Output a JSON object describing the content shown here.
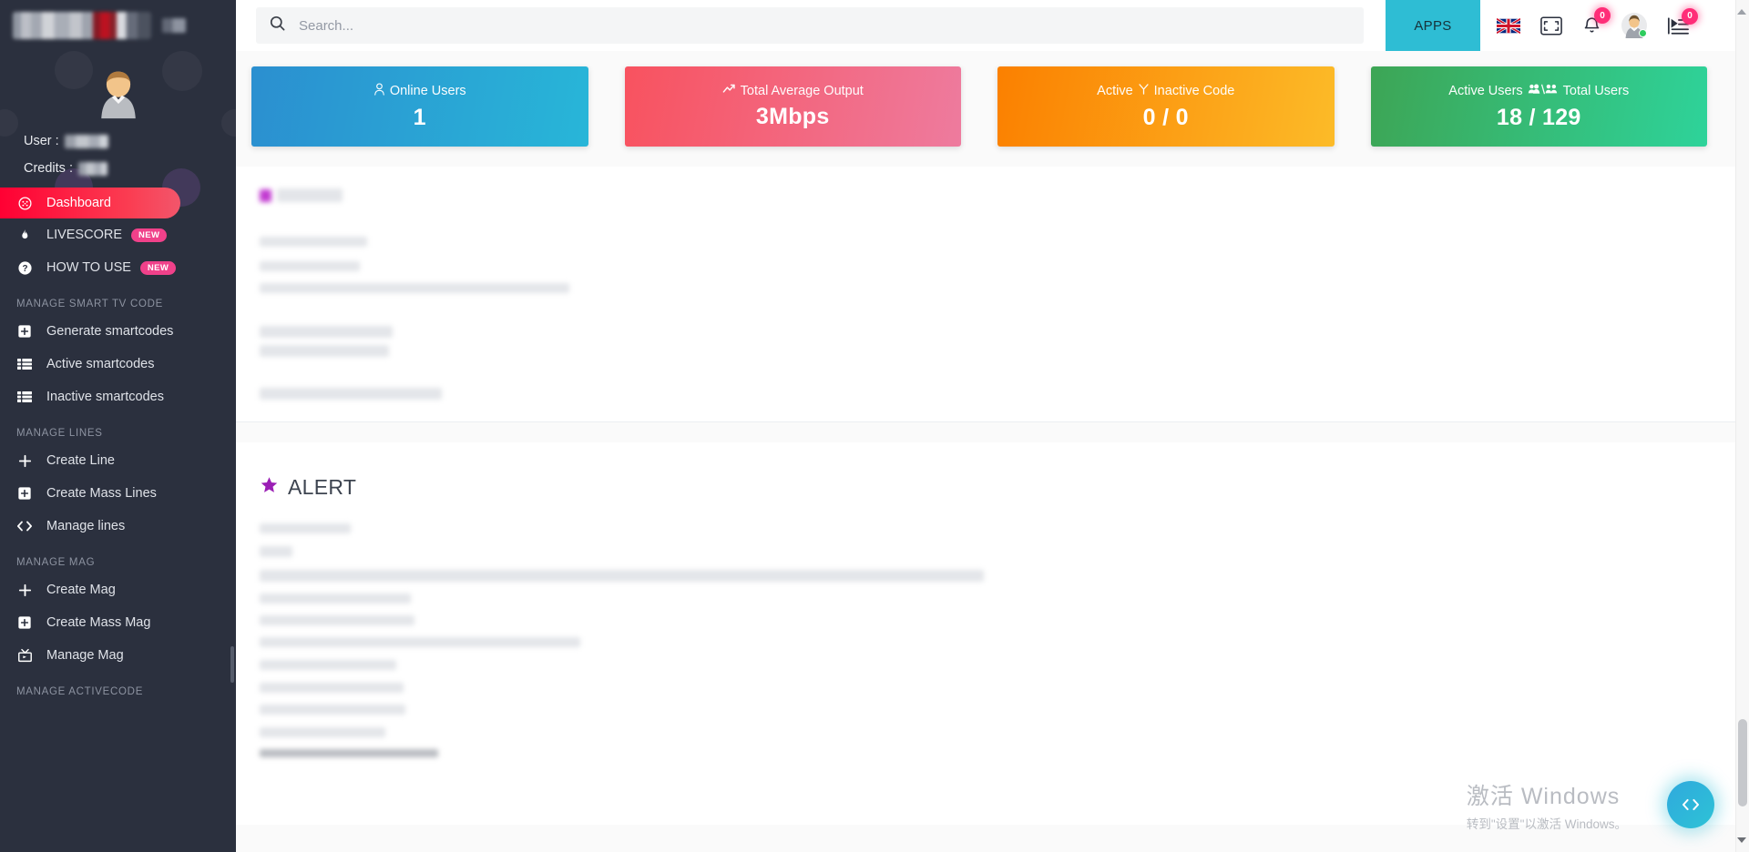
{
  "sidebar": {
    "logo_redacted": true,
    "profile": {
      "user_label": "User :",
      "credits_label": "Credits :",
      "user_value_redacted": true,
      "credits_value_redacted": true
    },
    "items": [
      {
        "label": "Dashboard",
        "icon": "dashboard-icon",
        "active": true,
        "badge": ""
      },
      {
        "label": "LIVESCORE",
        "icon": "flame-icon",
        "active": false,
        "badge": "NEW"
      },
      {
        "label": "HOW TO USE",
        "icon": "question-icon",
        "active": false,
        "badge": "NEW"
      }
    ],
    "sections": [
      {
        "title": "MANAGE SMART TV CODE",
        "items": [
          {
            "label": "Generate smartcodes",
            "icon": "plus-box-icon"
          },
          {
            "label": "Active smartcodes",
            "icon": "list-icon"
          },
          {
            "label": "Inactive smartcodes",
            "icon": "list-icon"
          }
        ]
      },
      {
        "title": "MANAGE LINES",
        "items": [
          {
            "label": "Create Line",
            "icon": "plus-icon"
          },
          {
            "label": "Create Mass Lines",
            "icon": "plus-box-icon"
          },
          {
            "label": "Manage lines",
            "icon": "code-brackets-icon"
          }
        ]
      },
      {
        "title": "MANAGE MAG",
        "items": [
          {
            "label": "Create Mag",
            "icon": "plus-icon"
          },
          {
            "label": "Create Mass Mag",
            "icon": "plus-box-icon"
          },
          {
            "label": "Manage Mag",
            "icon": "tv-icon"
          }
        ]
      },
      {
        "title": "MANAGE ACTIVECODE",
        "items": []
      }
    ]
  },
  "topbar": {
    "search_placeholder": "Search...",
    "search_value": "",
    "apps_label": "APPS",
    "language_icon": "uk-flag-icon",
    "fullscreen_icon": "fullscreen-icon",
    "notifications": {
      "icon": "bell-icon",
      "count": "0"
    },
    "avatar_icon": "avatar-icon",
    "messages": {
      "icon": "playlist-icon",
      "count": "0"
    }
  },
  "cards": [
    {
      "title": "Online Users",
      "value": "1",
      "icon": "person-icon",
      "color": "#2b8fd0"
    },
    {
      "title": "Total Average Output",
      "value": "3Mbps",
      "icon": "trend-up-icon",
      "color": "#f8525f"
    },
    {
      "title": "Active",
      "title2": "Inactive Code",
      "value": "0 / 0",
      "icon": "filter-icon",
      "color": "#fb8000"
    },
    {
      "title": "Active Users",
      "title2": "Total Users",
      "value": "18 / 129",
      "icon": "group-icon",
      "color": "#3da555"
    }
  ],
  "alert": {
    "title": "ALERT",
    "star_icon": "star-icon",
    "star_color": "#9b1fb5"
  },
  "watermark": {
    "line1": "激活 Windows",
    "line2": "转到\"设置\"以激活 Windows。"
  },
  "fab": {
    "icon": "code-brackets-icon",
    "label": "<>"
  }
}
